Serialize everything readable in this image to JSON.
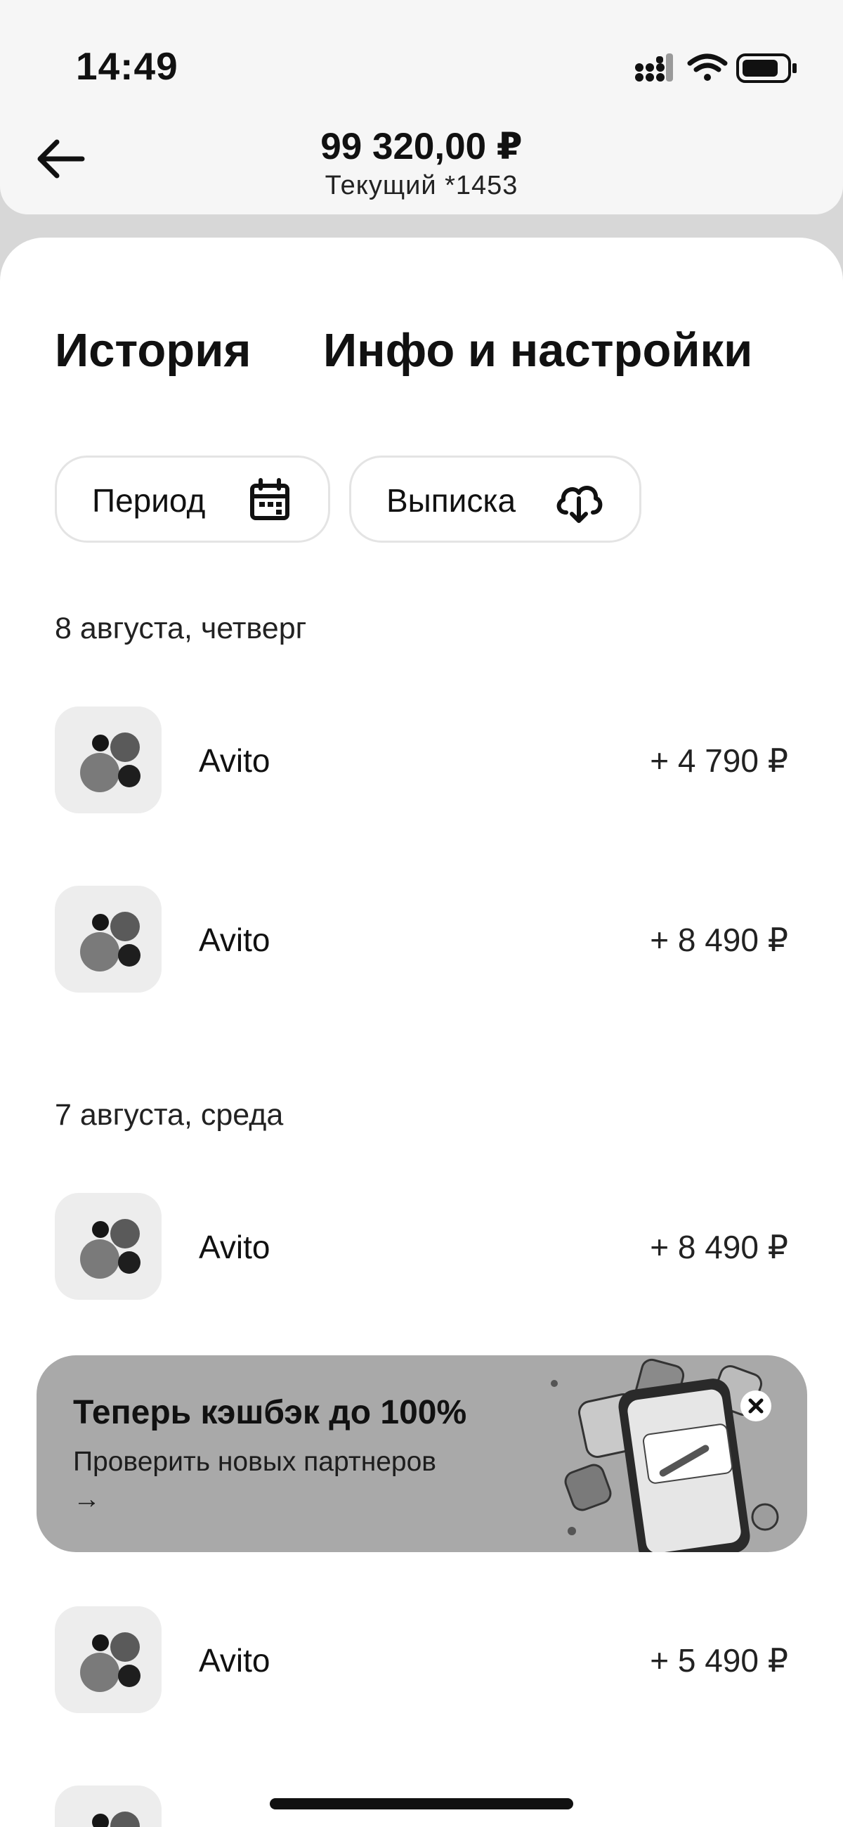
{
  "status_bar": {
    "time": "14:49"
  },
  "header": {
    "balance": "99 320,00 ₽",
    "account": "Текущий *1453"
  },
  "tabs": [
    {
      "label": "История"
    },
    {
      "label": "Инфо и настройки"
    }
  ],
  "filters": {
    "period_label": "Период",
    "statement_label": "Выписка"
  },
  "groups": [
    {
      "date": "8 августа, четверг",
      "transactions": [
        {
          "name": "Avito",
          "amount": "+ 4 790 ₽"
        },
        {
          "name": "Avito",
          "amount": "+ 8 490 ₽"
        }
      ]
    },
    {
      "date": "7 августа, среда",
      "transactions": [
        {
          "name": "Avito",
          "amount": "+ 8 490 ₽"
        },
        {
          "name": "Avito",
          "amount": "+ 5 490 ₽"
        }
      ]
    }
  ],
  "promo": {
    "title": "Теперь кэшбэк до 100%",
    "subtitle": "Проверить новых партнеров",
    "arrow": "→"
  },
  "colors": {
    "sheet_bg": "#ffffff",
    "page_bg": "#d7d7d7",
    "promo_bg": "#a9a9a9",
    "logo_bg": "#ededed"
  },
  "icons": {
    "back": "arrow-left-icon",
    "period": "calendar-icon",
    "statement": "cloud-download-icon",
    "promo_close": "close-icon",
    "merchant_logo": "avito-logo-icon"
  }
}
